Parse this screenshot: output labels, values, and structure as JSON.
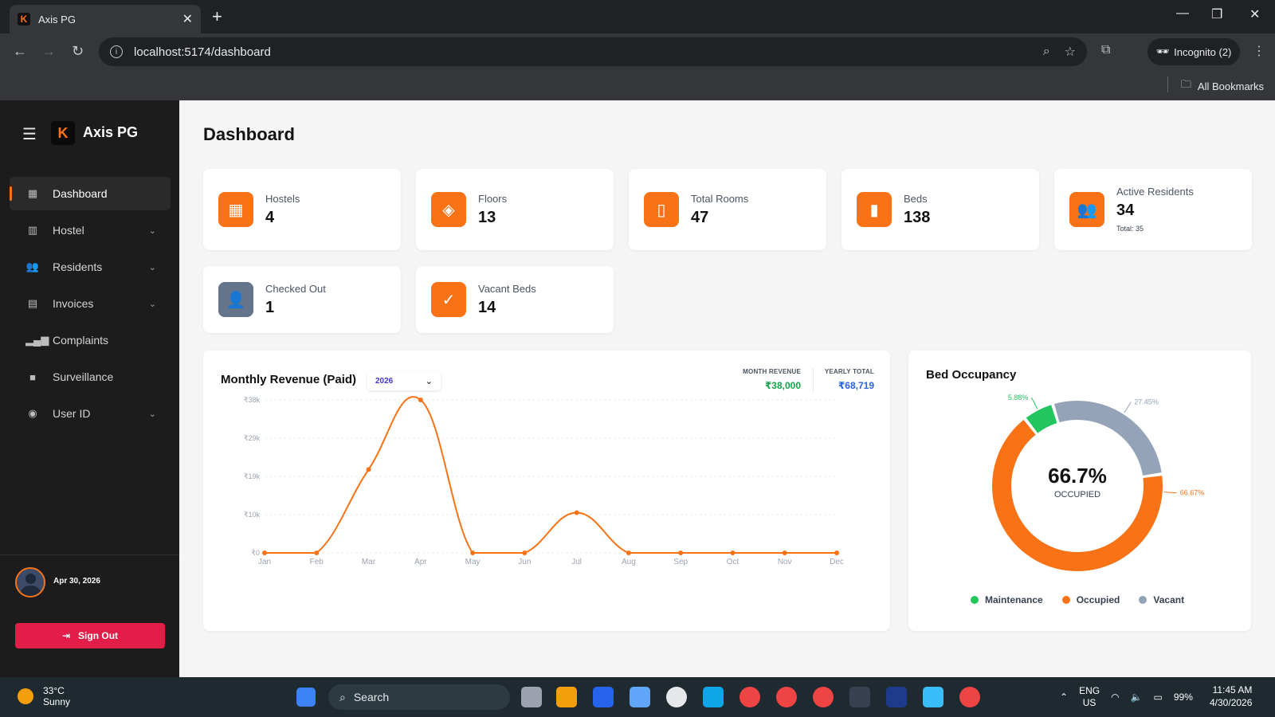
{
  "browser": {
    "tab_title": "Axis PG",
    "url": "localhost:5174/dashboard",
    "incognito_label": "Incognito (2)",
    "all_bookmarks": "All Bookmarks"
  },
  "sidebar": {
    "brand": "Axis PG",
    "items": [
      {
        "label": "Dashboard",
        "icon": "grid-icon",
        "active": true,
        "expandable": false
      },
      {
        "label": "Hostel",
        "icon": "building-icon",
        "active": false,
        "expandable": true
      },
      {
        "label": "Residents",
        "icon": "users-icon",
        "active": false,
        "expandable": true
      },
      {
        "label": "Invoices",
        "icon": "receipt-icon",
        "active": false,
        "expandable": true
      },
      {
        "label": "Complaints",
        "icon": "bar-chart-icon",
        "active": false,
        "expandable": false
      },
      {
        "label": "Surveillance",
        "icon": "camera-icon",
        "active": false,
        "expandable": false
      },
      {
        "label": "User ID",
        "icon": "user-circle-icon",
        "active": false,
        "expandable": true
      }
    ],
    "date": "Apr 30, 2026",
    "sign_out": "Sign Out"
  },
  "main": {
    "title": "Dashboard",
    "stats": [
      {
        "label": "Hostels",
        "value": "4",
        "icon": "building-icon"
      },
      {
        "label": "Floors",
        "value": "13",
        "icon": "layers-icon"
      },
      {
        "label": "Total Rooms",
        "value": "47",
        "icon": "door-icon"
      },
      {
        "label": "Beds",
        "value": "138",
        "icon": "bed-icon"
      },
      {
        "label": "Active Residents",
        "value": "34",
        "sub": "Total: 35",
        "icon": "users-icon"
      },
      {
        "label": "Checked Out",
        "value": "1",
        "icon": "user-x-icon"
      },
      {
        "label": "Vacant Beds",
        "value": "14",
        "icon": "check-circle-icon"
      }
    ],
    "revenue": {
      "title": "Monthly Revenue (Paid)",
      "year": "2026",
      "month_revenue_label": "MONTH REVENUE",
      "month_revenue_value": "₹38,000",
      "yearly_total_label": "YEARLY TOTAL",
      "yearly_total_value": "₹68,719"
    },
    "occupancy": {
      "title": "Bed Occupancy",
      "center_value": "66.7%",
      "center_label": "OCCUPIED"
    }
  },
  "chart_data": [
    {
      "type": "line",
      "title": "Monthly Revenue (Paid)",
      "categories": [
        "Jan",
        "Feb",
        "Mar",
        "Apr",
        "May",
        "Jun",
        "Jul",
        "Aug",
        "Sep",
        "Oct",
        "Nov",
        "Dec"
      ],
      "values": [
        0,
        0,
        20719,
        38000,
        0,
        0,
        10000,
        0,
        0,
        0,
        0,
        0
      ],
      "yticks": [
        "₹0",
        "₹10k",
        "₹19k",
        "₹29k",
        "₹38k"
      ],
      "ytick_values": [
        0,
        9500,
        19000,
        28500,
        38000
      ],
      "ylim": [
        0,
        38000
      ],
      "color": "#f97316",
      "grid": true
    },
    {
      "type": "pie",
      "title": "Bed Occupancy",
      "labels": [
        "Occupied",
        "Maintenance",
        "Vacant"
      ],
      "values": [
        66.67,
        5.88,
        27.45
      ],
      "value_labels": [
        "66.67%",
        "5.88%",
        "27.45%"
      ],
      "colors": [
        "#f97316",
        "#22c55e",
        "#94a3b8"
      ],
      "legend": [
        {
          "label": "Maintenance",
          "color": "#22c55e"
        },
        {
          "label": "Occupied",
          "color": "#f97316"
        },
        {
          "label": "Vacant",
          "color": "#94a3b8"
        }
      ],
      "legend_position": "bottom"
    }
  ],
  "taskbar": {
    "temperature": "33°C",
    "condition": "Sunny",
    "search": "Search",
    "lang1": "ENG",
    "lang2": "US",
    "battery": "99%",
    "time": "11:45 AM",
    "date": "4/30/2026"
  }
}
